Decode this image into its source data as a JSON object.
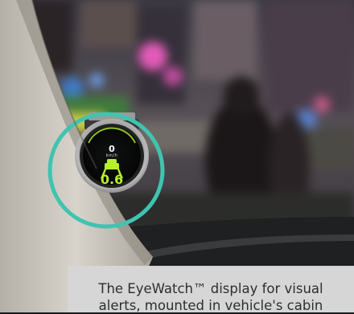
{
  "photo": {
    "description_icon": "car-interior-photo",
    "highlight_color": "#3fc4b0"
  },
  "device": {
    "speed_value": "0",
    "speed_unit": "km/h",
    "distance_value": "0.6",
    "accent_color": "#b6f02a"
  },
  "caption": {
    "text": "The EyeWatch™ display for visual\nalerts, mounted in vehicle's cabin"
  }
}
